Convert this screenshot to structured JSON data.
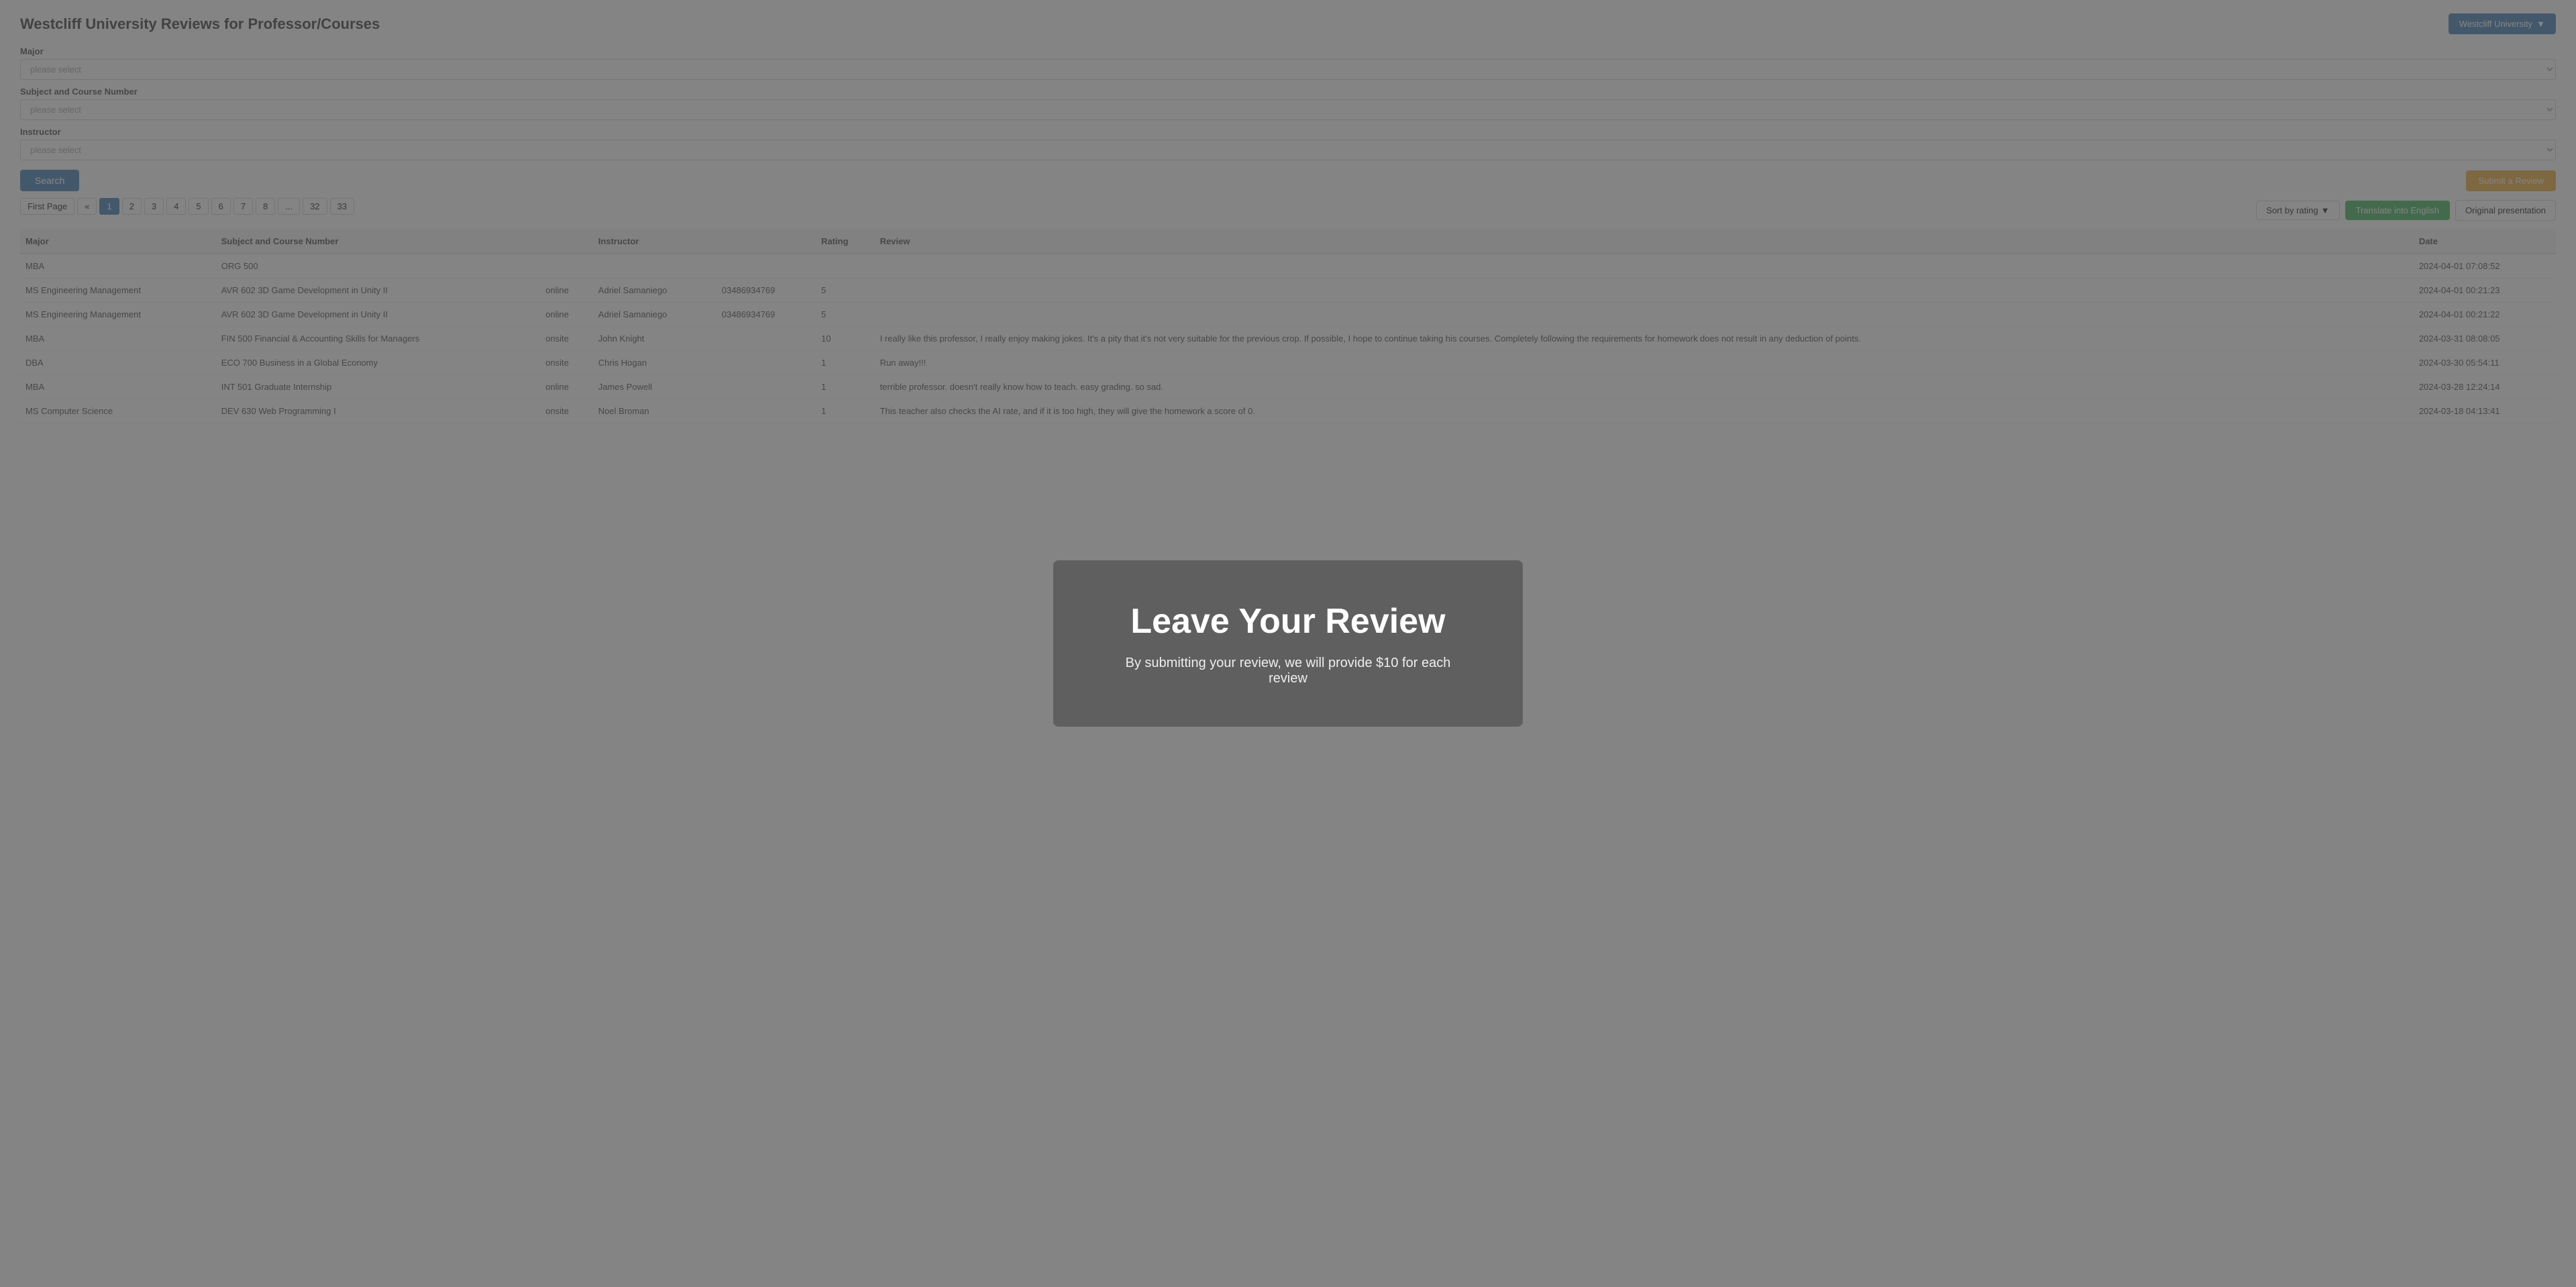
{
  "header": {
    "title": "Westcliff University Reviews for Professor/Courses",
    "university_btn_label": "Westcliff University",
    "chevron": "▼"
  },
  "form": {
    "major_label": "Major",
    "major_placeholder": "please select",
    "course_label": "Subject and Course Number",
    "course_placeholder": "please select",
    "instructor_label": "Instructor",
    "instructor_placeholder": "please select"
  },
  "actions": {
    "search_label": "Search",
    "submit_review_label": "Submit a Review"
  },
  "pagination": {
    "first_label": "First Page",
    "prev_label": "«",
    "pages": [
      "1",
      "2",
      "3",
      "4",
      "5",
      "6",
      "7",
      "8",
      "...",
      "32",
      "33"
    ],
    "active_page": "1"
  },
  "controls": {
    "sort_label": "Sort by rating",
    "sort_chevron": "▼",
    "translate_label": "Translate into English",
    "original_label": "Original presentation"
  },
  "table": {
    "columns": [
      "Major",
      "Subject and Course Number",
      "",
      "Instructor",
      "",
      "Rating",
      "Review",
      "Date"
    ],
    "rows": [
      {
        "major": "MBA",
        "course": "ORG 500",
        "mode": "",
        "instructor": "",
        "student_id": "",
        "rating": "",
        "review": "",
        "date": "2024-04-01 07:08:52"
      },
      {
        "major": "MS Engineering Management",
        "course": "AVR 602 3D Game Development in Unity II",
        "mode": "online",
        "instructor": "Adriel Samaniego",
        "student_id": "03486934769",
        "rating": "5",
        "review": "",
        "date": "2024-04-01 00:21:23"
      },
      {
        "major": "MS Engineering Management",
        "course": "AVR 602 3D Game Development in Unity II",
        "mode": "online",
        "instructor": "Adriel Samaniego",
        "student_id": "03486934769",
        "rating": "5",
        "review": "",
        "date": "2024-04-01 00:21:22"
      },
      {
        "major": "MBA",
        "course": "FIN 500 Financial & Accounting Skills for Managers",
        "mode": "onsite",
        "instructor": "John Knight",
        "student_id": "",
        "rating": "10",
        "review": "I really like this professor, I really enjoy making jokes. It's a pity that it's not very suitable for the previous crop. If possible, I hope to continue taking his courses. Completely following the requirements for homework does not result in any deduction of points.",
        "date": "2024-03-31 08:08:05"
      },
      {
        "major": "DBA",
        "course": "ECO 700 Business in a Global Economy",
        "mode": "onsite",
        "instructor": "Chris Hogan",
        "student_id": "",
        "rating": "1",
        "review": "Run away!!!",
        "date": "2024-03-30 05:54:11"
      },
      {
        "major": "MBA",
        "course": "INT 501 Graduate Internship",
        "mode": "online",
        "instructor": "James Powell",
        "student_id": "",
        "rating": "1",
        "review": "terrible professor. doesn't really know how to teach. easy grading. so sad.",
        "date": "2024-03-28 12:24:14"
      },
      {
        "major": "MS Computer Science",
        "course": "DEV 630 Web Programming I",
        "mode": "onsite",
        "instructor": "Noel Broman",
        "student_id": "",
        "rating": "1",
        "review": "This teacher also checks the AI rate, and if it is too high, they will give the homework a score of 0.",
        "date": "2024-03-18 04:13:41"
      }
    ]
  },
  "overlay": {
    "title": "Leave Your Review",
    "subtitle": "By submitting your review, we will provide $10 for each review"
  }
}
